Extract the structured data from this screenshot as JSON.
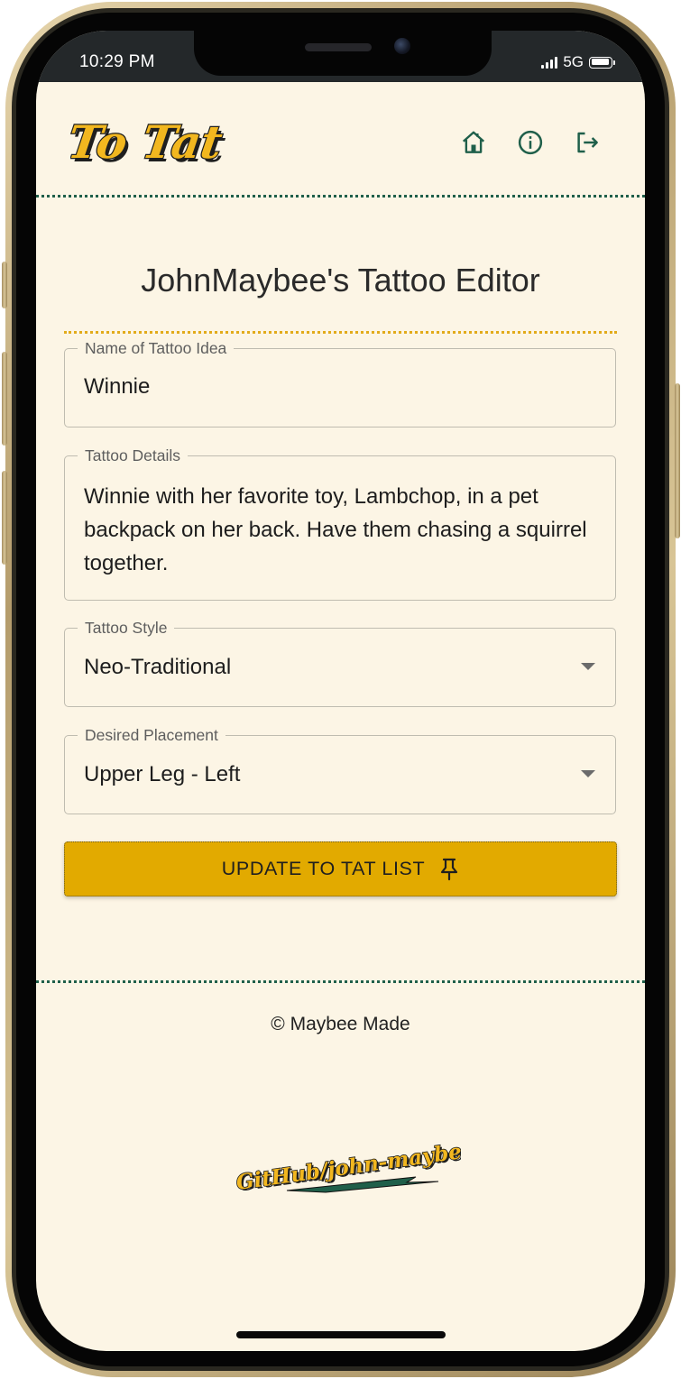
{
  "status_bar": {
    "time": "10:29 PM",
    "network": "5G"
  },
  "header": {
    "logo_text": "To Tat",
    "nav": [
      {
        "icon": "home-icon",
        "label": "Home"
      },
      {
        "icon": "info-icon",
        "label": "About"
      },
      {
        "icon": "logout-icon",
        "label": "Log out"
      }
    ]
  },
  "page": {
    "title": "JohnMaybee's Tattoo Editor"
  },
  "form": {
    "name_label": "Name of Tattoo Idea",
    "name_value": "Winnie",
    "details_label": "Tattoo Details",
    "details_value": "Winnie with her favorite toy, Lambchop, in a pet backpack on her back. Have them chasing a squirrel together.",
    "style_label": "Tattoo Style",
    "style_value": "Neo-Traditional",
    "placement_label": "Desired Placement",
    "placement_value": "Upper Leg - Left",
    "submit_label": "UPDATE TO TAT LIST",
    "submit_icon": "pin-icon"
  },
  "footer": {
    "copyright": "© Maybee Made",
    "github_link_text": "GitHub/john-maybee"
  },
  "colors": {
    "background": "#fcf5e5",
    "primary_green": "#1f5f4a",
    "accent_gold": "#e2aa00",
    "logo_yellow": "#f2b71f"
  }
}
